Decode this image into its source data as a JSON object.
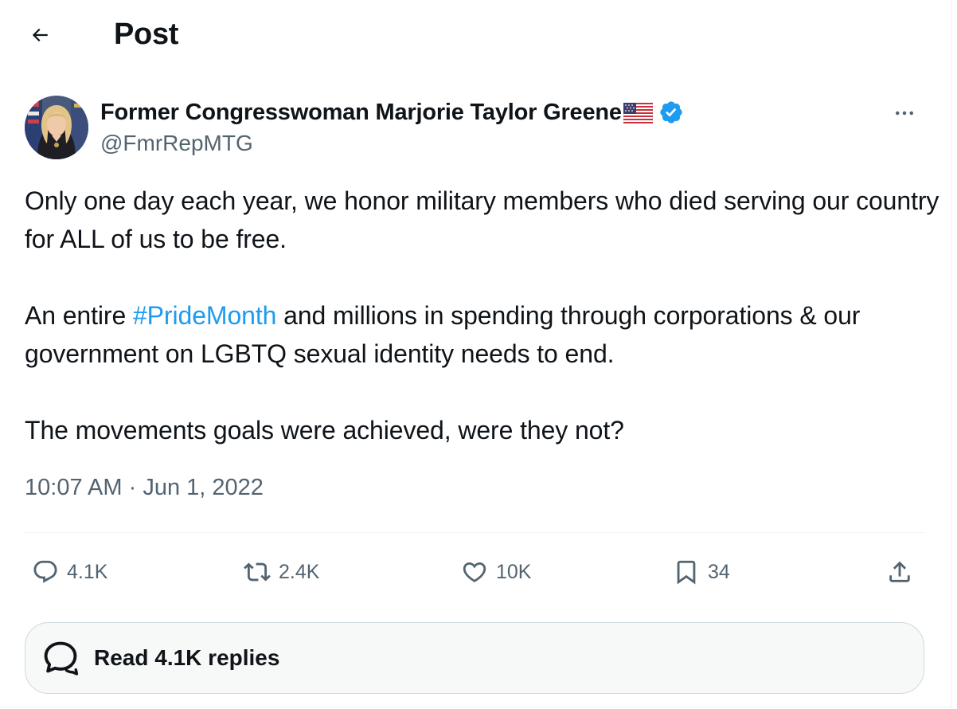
{
  "header": {
    "title": "Post",
    "back_icon": "arrow-left-icon"
  },
  "author": {
    "display_name": "Former Congresswoman Marjorie Taylor Greene",
    "name_emoji": "us-flag-icon",
    "verified_icon": "verified-badge-icon",
    "verified_color": "#1d9bf0",
    "handle": "@FmrRepMTG"
  },
  "tweet": {
    "paragraph1": "Only one day each year, we honor military members who died serving our country for ALL of us to be free.",
    "paragraph2_before": "An entire ",
    "hashtag": "#PrideMonth",
    "paragraph2_after": " and millions in spending through corporations & our government on LGBTQ sexual identity needs to end.",
    "paragraph3": "The movements goals were achieved, were they not?"
  },
  "timestamp": {
    "time": "10:07 AM",
    "separator": " · ",
    "date": "Jun 1, 2022"
  },
  "actions": {
    "replies": "4.1K",
    "reposts": "2.4K",
    "likes": "10K",
    "bookmarks": "34"
  },
  "read_replies": {
    "label": "Read 4.1K replies"
  },
  "colors": {
    "link": "#1d9bf0",
    "text": "#0f1419",
    "secondary": "#536471",
    "border": "#eff3f4"
  }
}
